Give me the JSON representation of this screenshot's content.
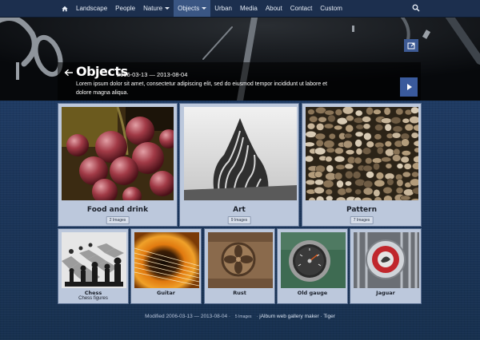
{
  "nav": {
    "items": [
      {
        "label": "Landscape",
        "dropdown": false,
        "active": false
      },
      {
        "label": "People",
        "dropdown": false,
        "active": false
      },
      {
        "label": "Nature",
        "dropdown": true,
        "active": false
      },
      {
        "label": "Objects",
        "dropdown": true,
        "active": true
      },
      {
        "label": "Urban",
        "dropdown": false,
        "active": false
      },
      {
        "label": "Media",
        "dropdown": false,
        "active": false
      },
      {
        "label": "About",
        "dropdown": false,
        "active": false
      },
      {
        "label": "Contact",
        "dropdown": false,
        "active": false
      },
      {
        "label": "Custom",
        "dropdown": false,
        "active": false
      }
    ],
    "home_icon": "home-icon",
    "search_icon": "search-icon"
  },
  "album": {
    "title": "Objects",
    "date_range": "2006-03-13 — 2013-08-04",
    "description": "Lorem ipsum dolor sit amet, consectetur adipiscing elit, sed do eiusmod tempor incididunt ut labore et dolore magna aliqua.",
    "back_icon": "back-arrow-icon",
    "share_icon": "share-icon",
    "play_icon": "play-icon"
  },
  "folders": [
    {
      "title": "Food and drink",
      "count": "2 Images"
    },
    {
      "title": "Art",
      "count": "9 Images"
    },
    {
      "title": "Pattern",
      "count": "7 Images"
    }
  ],
  "images": [
    {
      "title": "Chess",
      "caption": "Chess figures"
    },
    {
      "title": "Guitar",
      "caption": ""
    },
    {
      "title": "Rust",
      "caption": ""
    },
    {
      "title": "Old gauge",
      "caption": ""
    },
    {
      "title": "Jaguar",
      "caption": ""
    }
  ],
  "footer": {
    "modified": "Modified 2006-03-13 — 2013-08-04 ·",
    "count": "5 Images",
    "separator": "·",
    "credit": "jAlbum web gallery maker · Tiger"
  },
  "colors": {
    "accent": "#3a5a9c",
    "card_bg": "#bcc8dc",
    "nav_bg": "#1c2f4e",
    "page_bg": "#1d3557"
  }
}
